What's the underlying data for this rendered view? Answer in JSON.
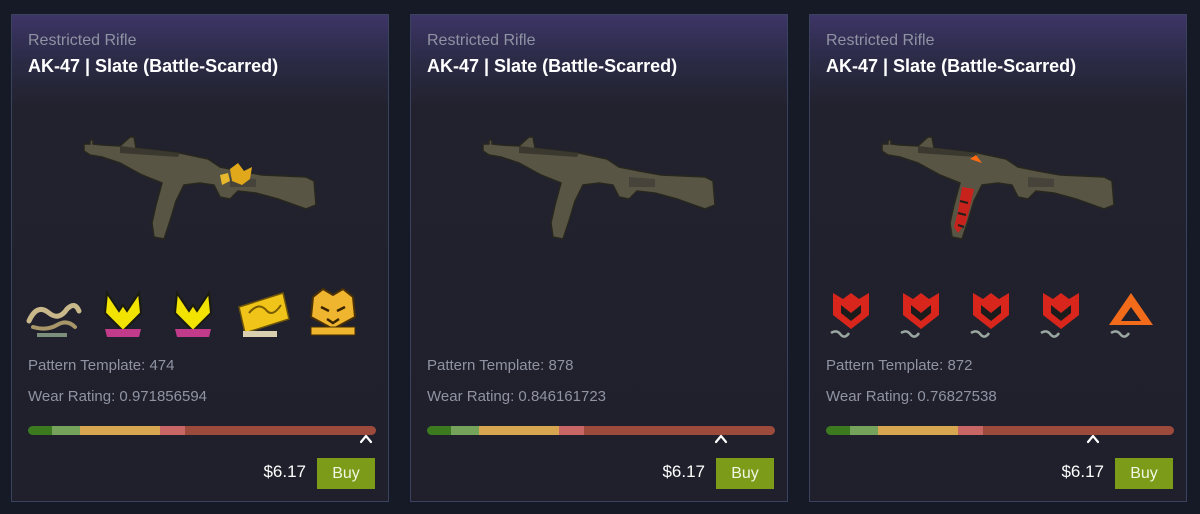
{
  "colors": {
    "wear_bar": [
      "#3c7a1f",
      "#76a35c",
      "#d7a650",
      "#c86565",
      "#9b4a3b"
    ],
    "buy_button": "#7b9b19",
    "background": "#161a26"
  },
  "cards": [
    {
      "rarity": "Restricted Rifle",
      "name": "AK-47 | Slate (Battle-Scarred)",
      "pattern_label": "Pattern Template: 474",
      "wear_label": "Wear Rating: 0.971856594",
      "wear_value": 0.971856594,
      "price": "$6.17",
      "buy_label": "Buy",
      "rifle_decal": "gold-crest",
      "stickers": [
        "dragon-sticker",
        "vitality-bee-sticker",
        "vitality-bee-sticker",
        "champion-banner-sticker",
        "lynn-vision-tiger-sticker"
      ]
    },
    {
      "rarity": "Restricted Rifle",
      "name": "AK-47 | Slate (Battle-Scarred)",
      "pattern_label": "Pattern Template: 878",
      "wear_label": "Wear Rating: 0.846161723",
      "wear_value": 0.846161723,
      "price": "$6.17",
      "buy_label": "Buy",
      "rifle_decal": "none",
      "stickers": []
    },
    {
      "rarity": "Restricted Rifle",
      "name": "AK-47 | Slate (Battle-Scarred)",
      "pattern_label": "Pattern Template: 872",
      "wear_label": "Wear Rating: 0.76827538",
      "wear_value": 0.76827538,
      "price": "$6.17",
      "buy_label": "Buy",
      "rifle_decal": "red-mouz",
      "stickers": [
        "mouz-sticker",
        "mouz-sticker",
        "mouz-sticker",
        "mouz-sticker",
        "orange-triangle-sticker"
      ]
    }
  ]
}
